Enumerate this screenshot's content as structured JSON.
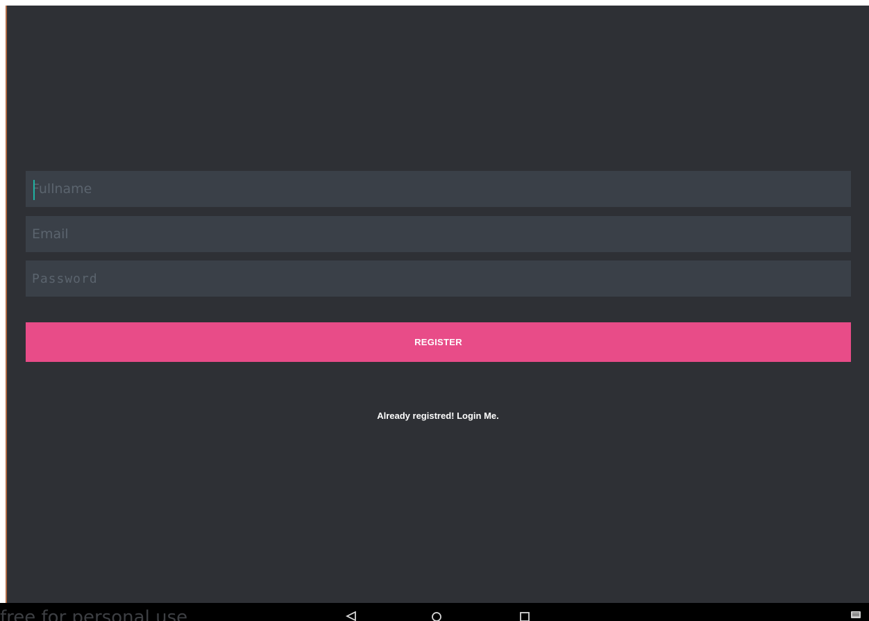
{
  "form": {
    "fullname_placeholder": "Fullname",
    "email_placeholder": "Email",
    "password_placeholder": "Password",
    "register_label": "REGISTER",
    "login_link_text": "Already registred! Login Me."
  },
  "navbar": {
    "watermark_text": "free for personal use",
    "back_icon": "back-icon",
    "home_icon": "home-icon",
    "recents_icon": "recents-icon",
    "keyboard_icon": "keyboard-icon"
  },
  "colors": {
    "background": "#2e3035",
    "field_background": "#3a4048",
    "accent": "#e84c88",
    "cursor": "#1fb3a3",
    "navbar": "#000000"
  }
}
